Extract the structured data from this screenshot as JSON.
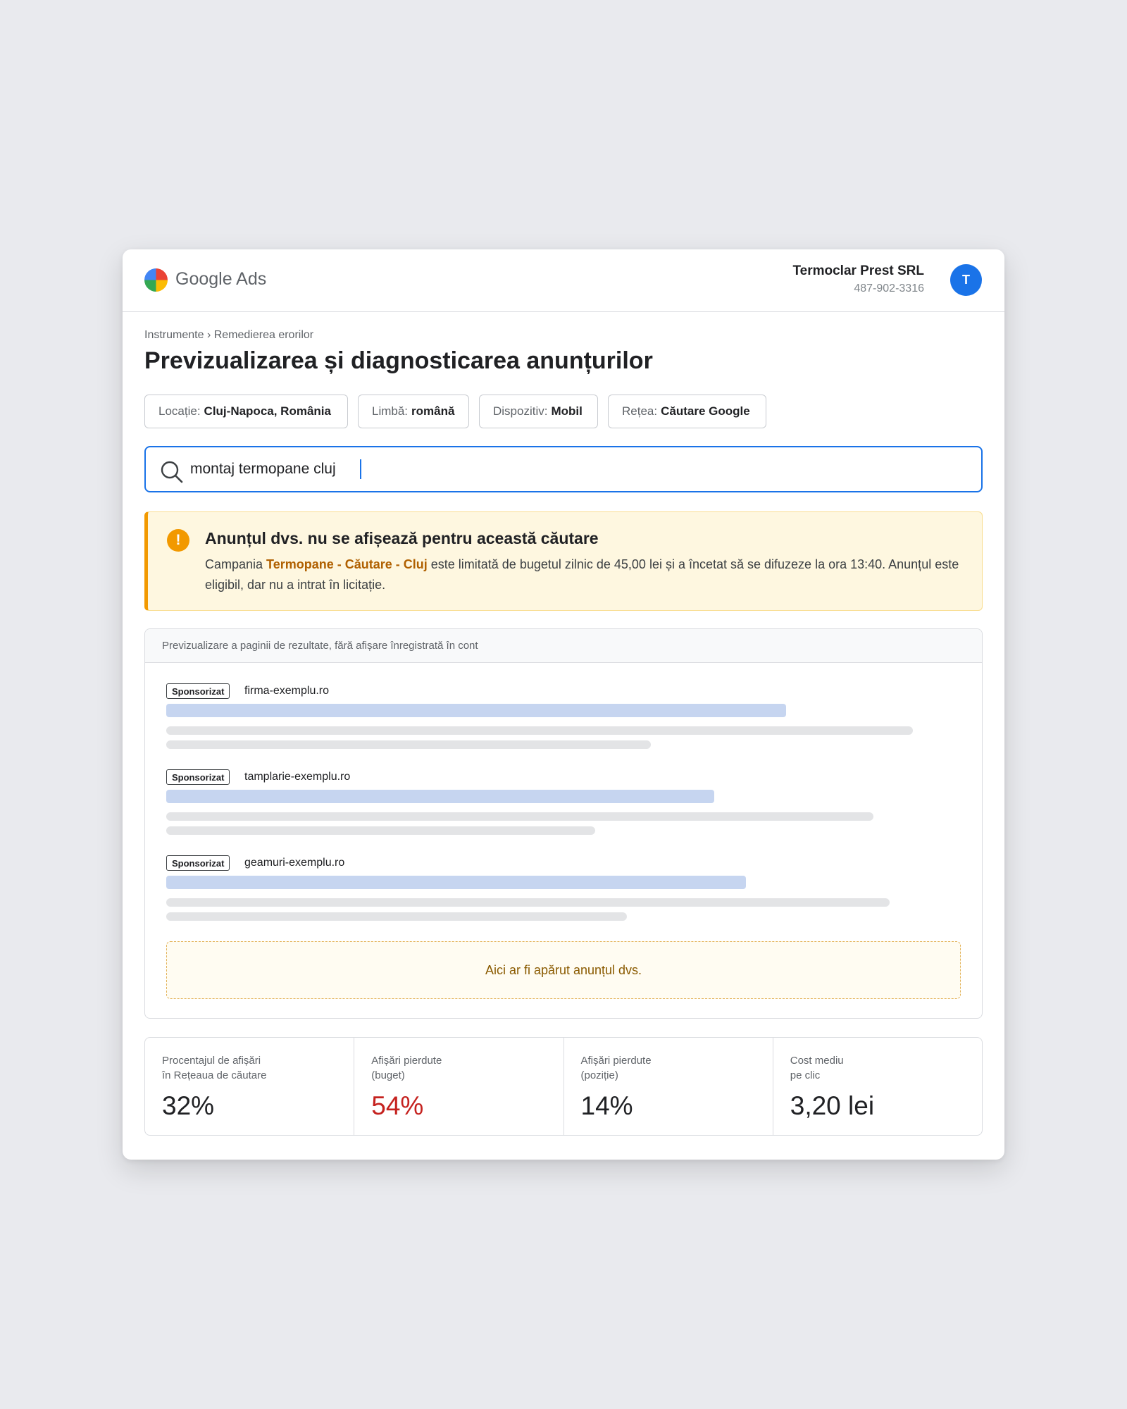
{
  "header": {
    "brand": "Google Ads",
    "account_name": "Termoclar Prest SRL",
    "account_id": "487-902-3316",
    "avatar_initial": "T"
  },
  "breadcrumb": {
    "parent": "Instrumente",
    "separator": "›",
    "current": "Remedierea erorilor"
  },
  "page_title": "Previzualizarea și diagnosticarea anunțurilor",
  "filters": [
    {
      "label": "Locație:",
      "value": "Cluj-Napoca, România"
    },
    {
      "label": "Limbă:",
      "value": "română"
    },
    {
      "label": "Dispozitiv:",
      "value": "Mobil"
    },
    {
      "label": "Rețea:",
      "value": "Căutare Google"
    }
  ],
  "search": {
    "value": "montaj termopane cluj"
  },
  "alert": {
    "title": "Anunțul dvs. nu se afișează pentru această căutare",
    "body_prefix": "Campania ",
    "campaign": "Termopane - Căutare - Cluj",
    "body_suffix": " este limitată de bugetul zilnic de 45,00 lei și a încetat să se difuzeze la ora 13:40. Anunțul este eligibil, dar nu a intrat în licitație."
  },
  "preview": {
    "header": "Previzualizare a paginii de rezultate, fără afișare înregistrată în cont",
    "ads": [
      {
        "badge": "Sponsorizat",
        "domain": "firma-exemplu.ro"
      },
      {
        "badge": "Sponsorizat",
        "domain": "tamplarie-exemplu.ro"
      },
      {
        "badge": "Sponsorizat",
        "domain": "geamuri-exemplu.ro"
      }
    ],
    "placeholder": "Aici ar fi apărut anunțul dvs."
  },
  "metrics": [
    {
      "label_line1": "Procentajul de afișări",
      "label_line2": "în Rețeaua de căutare",
      "value": "32%"
    },
    {
      "label_line1": "Afișări pierdute",
      "label_line2": "(buget)",
      "value": "54%"
    },
    {
      "label_line1": "Afișări pierdute",
      "label_line2": "(poziție)",
      "value": "14%"
    },
    {
      "label_line1": "Cost mediu",
      "label_line2": "pe clic",
      "value": "3,20 lei"
    }
  ],
  "colors": {
    "accent": "#1a73e8",
    "warning": "#f29900",
    "loss_value": "#c5221f",
    "campaign_link": "#b06000"
  },
  "icons": {
    "logo": "google-ads-logo",
    "search": "search-icon",
    "alert": "warning-icon"
  }
}
